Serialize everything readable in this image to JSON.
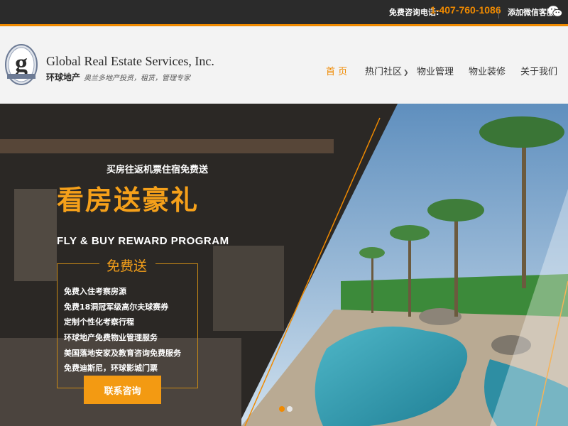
{
  "topbar": {
    "hotline_label": "免费咨询电话:",
    "hotline_number": "1-407-760-1086",
    "wechat_label": "添加微信客服:",
    "wechat_icon": "wechat-icon"
  },
  "header": {
    "logo_icon": "global-g-logo",
    "company_name_en": "Global Real Estate Services, Inc.",
    "company_name_cn": "环球地产",
    "slogan": "奥兰多地产投资，租赁，管理专家"
  },
  "nav": {
    "items": [
      {
        "label": "首 页",
        "active": true
      },
      {
        "label": "热门社区",
        "has_dropdown": true
      },
      {
        "label": "物业管理"
      },
      {
        "label": "物业装修"
      },
      {
        "label": "关于我们"
      }
    ]
  },
  "hero": {
    "subtitle": "买房往返机票住宿免费送",
    "title": "看房送豪礼",
    "title_en": "FLY & BUY REWARD PROGRAM",
    "free_label": "免费送",
    "benefits": [
      "免费入住考察房源",
      "免费18洞冠军级高尔夫球赛券",
      "定制个性化考察行程",
      "环球地产免费物业管理服务",
      "美国落地安家及教育咨询免费服务",
      "免费迪斯尼，环球影城门票"
    ],
    "cta_label": "联系咨询",
    "slides": 2,
    "active_slide": 1
  },
  "colors": {
    "accent": "#f08a00",
    "topbar_bg": "#2b2b2b",
    "header_bg": "#f3f3f3"
  }
}
